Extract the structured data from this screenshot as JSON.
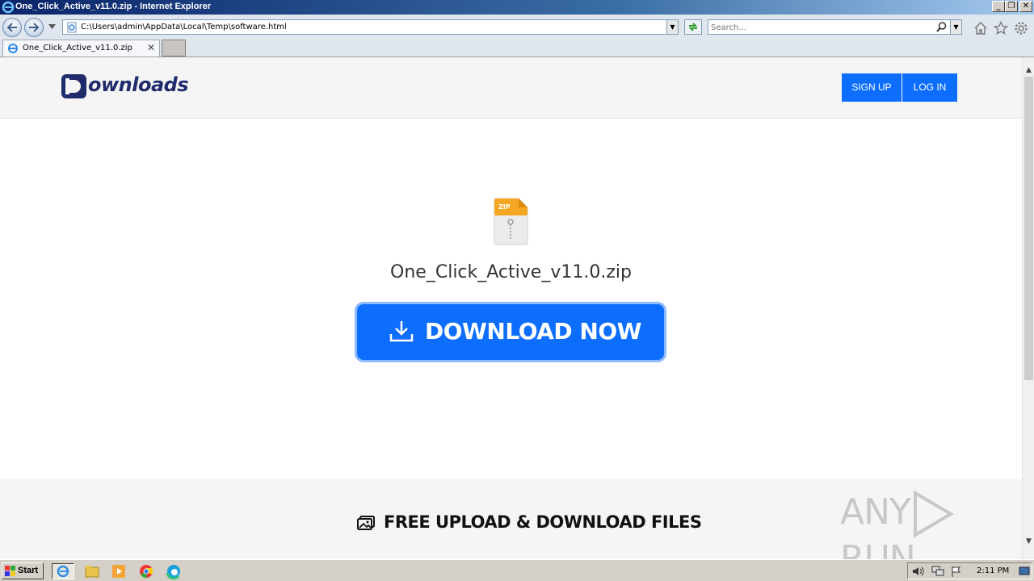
{
  "window": {
    "title": "One_Click_Active_v11.0.zip - Internet Explorer",
    "controls": {
      "minimize": "_",
      "restore": "❐",
      "close": "✕"
    }
  },
  "browser": {
    "address": "C:\\Users\\admin\\AppData\\Local\\Temp\\software.html",
    "search_placeholder": "Search...",
    "tab_label": "One_Click_Active_v11.0.zip",
    "tab_close": "✕"
  },
  "site": {
    "logo_text": "ownloads",
    "signup_label": "SIGN UP",
    "login_label": "LOG IN",
    "file_badge": "ZIP",
    "filename": "One_Click_Active_v11.0.zip",
    "download_label": "DOWNLOAD NOW",
    "footer_heading": "FREE UPLOAD & DOWNLOAD FILES",
    "brand_color": "#0d6efd",
    "logo_color": "#1f2b6b"
  },
  "watermark": {
    "left": "ANY",
    "right": "RUN"
  },
  "taskbar": {
    "start_label": "Start",
    "clock": "2:11 PM"
  }
}
